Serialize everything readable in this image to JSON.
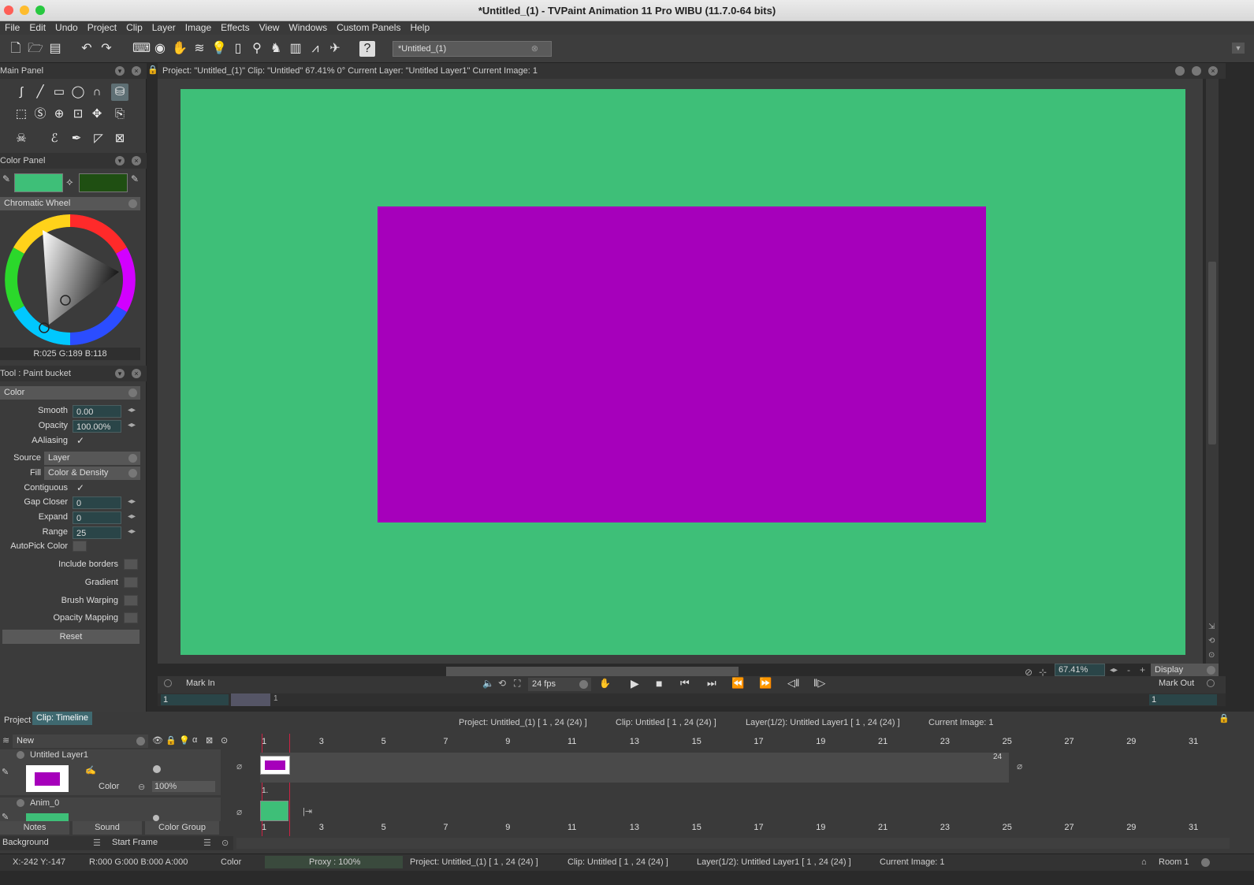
{
  "window": {
    "title": "*Untitled_(1) - TVPaint Animation 11 Pro WIBU (11.7.0-64 bits)"
  },
  "menu": [
    "File",
    "Edit",
    "Undo",
    "Project",
    "Clip",
    "Layer",
    "Image",
    "Effects",
    "View",
    "Windows",
    "Custom Panels",
    "Help"
  ],
  "toolbar": {
    "doc_tab": "*Untitled_(1)"
  },
  "main_panel": {
    "title": "Main Panel"
  },
  "color_panel": {
    "title": "Color Panel",
    "mode": "Chromatic Wheel",
    "rgb_readout": "R:025 G:189 B:118",
    "primary_color": "#3ebf78",
    "secondary_color": "#1f4f12"
  },
  "tool_panel": {
    "title": "Tool : Paint bucket",
    "mode": "Color",
    "smooth_label": "Smooth",
    "smooth_value": "0.00",
    "opacity_label": "Opacity",
    "opacity_value": "100.00%",
    "aaliasing_label": "AAliasing",
    "source_label": "Source",
    "source_value": "Layer",
    "fill_label": "Fill",
    "fill_value": "Color & Density",
    "contiguous_label": "Contiguous",
    "gap_closer_label": "Gap Closer",
    "gap_closer_value": "0",
    "expand_label": "Expand",
    "expand_value": "0",
    "range_label": "Range",
    "range_value": "25",
    "autopick_label": "AutoPick Color",
    "include_borders_label": "Include borders",
    "gradient_label": "Gradient",
    "brush_warping_label": "Brush Warping",
    "opacity_mapping_label": "Opacity Mapping",
    "reset_label": "Reset"
  },
  "view": {
    "header": "Project: \"Untitled_(1)\" Clip: \"Untitled\"  67.41%  0°  Current Layer: \"Untitled Layer1\"  Current Image: 1",
    "canvas_bg": "#3ebf78",
    "shape_color": "#a600bb",
    "zoom": "67.41%",
    "display_label": "Display",
    "mark_in": "Mark In",
    "mark_out": "Mark Out",
    "fps": "24 fps",
    "frame_start": "1",
    "frame_end": "1",
    "ruler_mark": "1"
  },
  "timeline": {
    "tab_project": "Project",
    "tab_clip": "Clip: Timeline",
    "info_project": "Project: Untitled_(1) [ 1 , 24  (24) ]",
    "info_clip": "Clip: Untitled [ 1 , 24  (24) ]",
    "info_layer": "Layer(1/2): Untitled Layer1 [ 1 , 24  (24) ]",
    "info_image": "Current Image: 1",
    "new_label": "New",
    "frame_numbers": [
      "1",
      "3",
      "5",
      "7",
      "9",
      "11",
      "13",
      "15",
      "17",
      "19",
      "21",
      "23",
      "25",
      "27",
      "29",
      "31"
    ],
    "layers": [
      {
        "name": "Untitled Layer1",
        "mode": "Color",
        "opacity": "100%",
        "end_frame": "24",
        "frame_label": "1."
      },
      {
        "name": "Anim_0"
      }
    ],
    "bottom_tabs": [
      "Notes",
      "Sound",
      "Color Group"
    ],
    "background_label": "Background",
    "start_frame_label": "Start Frame"
  },
  "status": {
    "coords": "X:-242  Y:-147",
    "rgba": "R:000 G:000 B:000 A:000",
    "mode": "Color",
    "proxy": "Proxy : 100%",
    "project": "Project: Untitled_(1) [ 1 , 24  (24) ]",
    "clip": "Clip: Untitled [ 1 , 24  (24) ]",
    "layer": "Layer(1/2): Untitled Layer1 [ 1 , 24  (24) ]",
    "image": "Current Image: 1",
    "room": "Room 1"
  }
}
